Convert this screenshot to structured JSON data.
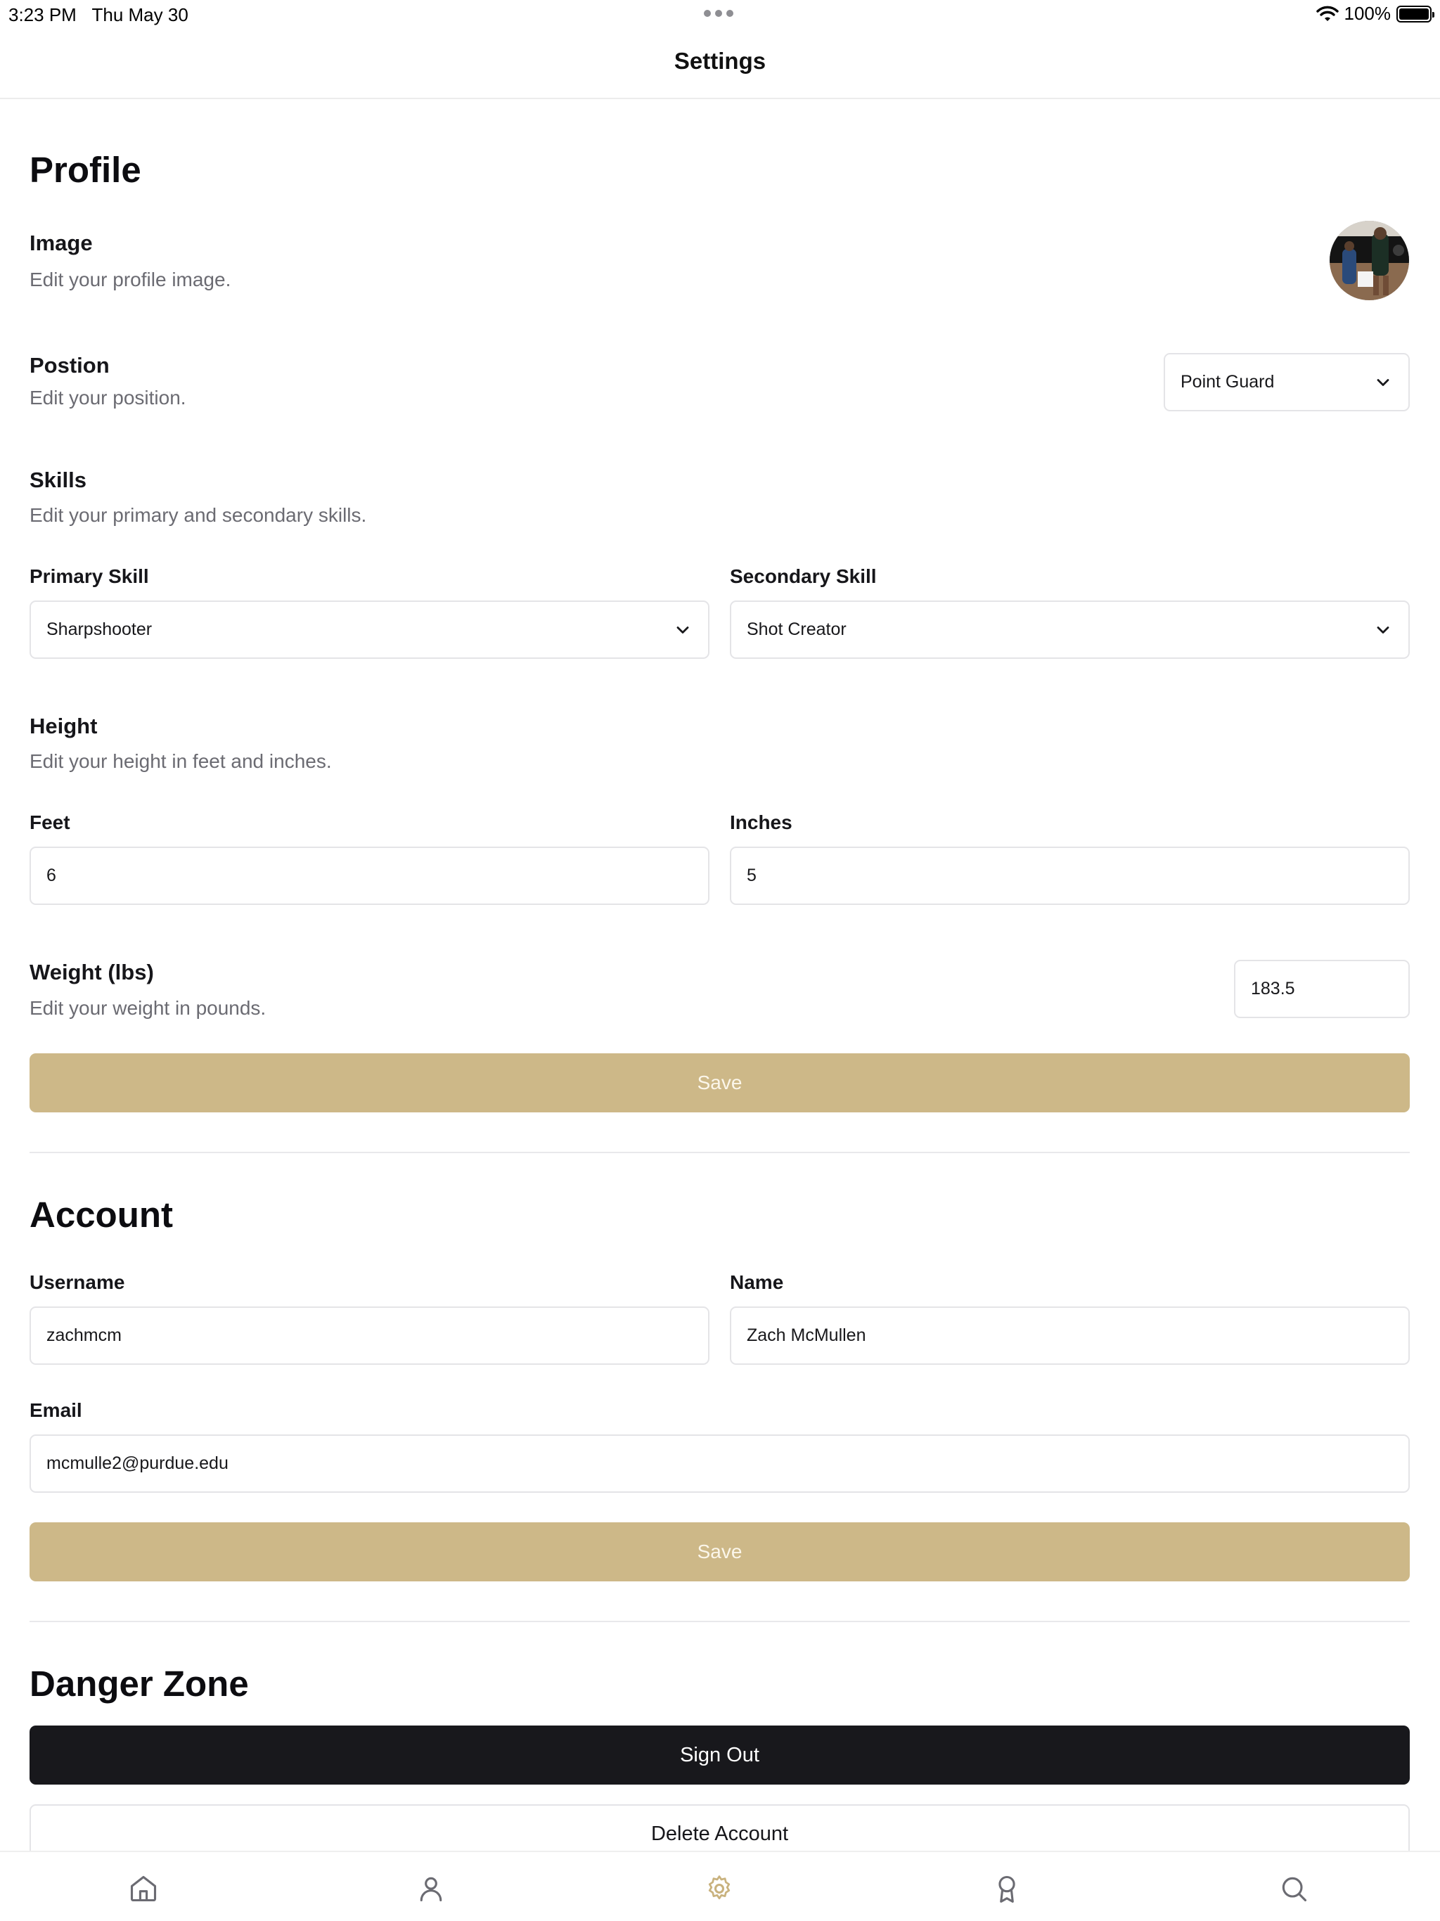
{
  "status_bar": {
    "time": "3:23 PM",
    "date": "Thu May 30",
    "battery": "100%"
  },
  "header": {
    "title": "Settings"
  },
  "profile": {
    "title": "Profile",
    "image": {
      "label": "Image",
      "description": "Edit your profile image."
    },
    "position": {
      "label": "Postion",
      "description": "Edit your position.",
      "value": "Point Guard"
    },
    "skills": {
      "label": "Skills",
      "description": "Edit your primary and secondary skills.",
      "primary_label": "Primary Skill",
      "primary_value": "Sharpshooter",
      "secondary_label": "Secondary Skill",
      "secondary_value": "Shot Creator"
    },
    "height": {
      "label": "Height",
      "description": "Edit your height in feet and inches.",
      "feet_label": "Feet",
      "feet_value": "6",
      "inches_label": "Inches",
      "inches_value": "5"
    },
    "weight": {
      "label": "Weight (lbs)",
      "description": "Edit your weight in pounds.",
      "value": "183.5"
    },
    "save_label": "Save"
  },
  "account": {
    "title": "Account",
    "username_label": "Username",
    "username_value": "zachmcm",
    "name_label": "Name",
    "name_value": "Zach McMullen",
    "email_label": "Email",
    "email_value": "mcmulle2@purdue.edu",
    "save_label": "Save"
  },
  "danger_zone": {
    "title": "Danger Zone",
    "sign_out_label": "Sign Out",
    "delete_label": "Delete Account"
  },
  "tab_bar": {
    "items": [
      {
        "icon": "home-icon",
        "active": false
      },
      {
        "icon": "user-icon",
        "active": false
      },
      {
        "icon": "gear-icon",
        "active": true
      },
      {
        "icon": "award-icon",
        "active": false
      },
      {
        "icon": "search-icon",
        "active": false
      }
    ]
  },
  "colors": {
    "accent": "#cdb888",
    "active_tab": "#c9b27e",
    "dark_button": "#18181c",
    "muted_text": "#6b6b72"
  }
}
